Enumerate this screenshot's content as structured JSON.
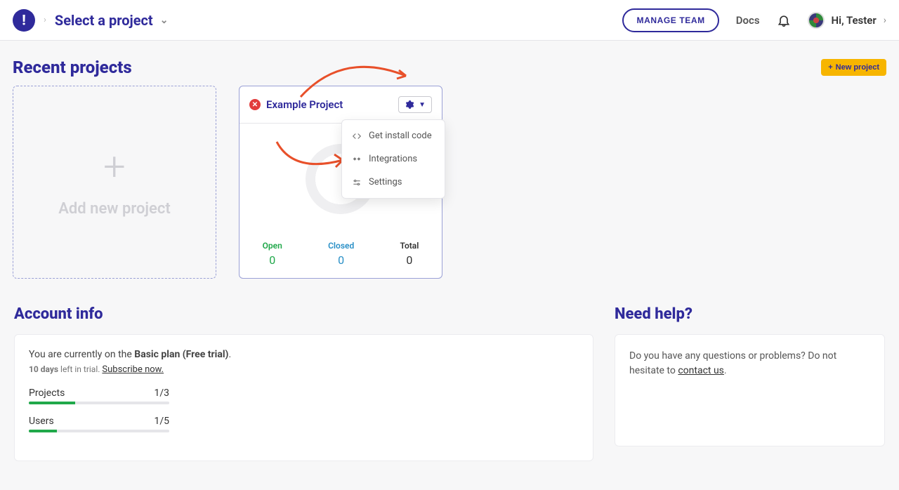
{
  "header": {
    "project_selector": "Select a project",
    "manage_team": "MANAGE TEAM",
    "docs": "Docs",
    "greeting": "Hi, Tester"
  },
  "recent": {
    "title": "Recent projects",
    "new_project_btn": "New project",
    "add_card_text": "Add new project"
  },
  "project": {
    "name": "Example Project",
    "stats": {
      "open_label": "Open",
      "open_value": "0",
      "closed_label": "Closed",
      "closed_value": "0",
      "total_label": "Total",
      "total_value": "0"
    }
  },
  "dropdown": {
    "install": "Get install code",
    "integrations": "Integrations",
    "settings": "Settings"
  },
  "account": {
    "title": "Account info",
    "plan_prefix": "You are currently on the ",
    "plan_name": "Basic plan (Free trial)",
    "plan_suffix": ".",
    "trial_days": "10 days",
    "trial_rest": " left in trial. ",
    "subscribe": "Subscribe now.",
    "projects_label": "Projects",
    "projects_value": "1/3",
    "projects_pct": 33,
    "users_label": "Users",
    "users_value": "1/5",
    "users_pct": 20
  },
  "help": {
    "title": "Need help?",
    "text_before": "Do you have any questions or problems? Do not hesitate to ",
    "link": "contact us",
    "text_after": "."
  }
}
